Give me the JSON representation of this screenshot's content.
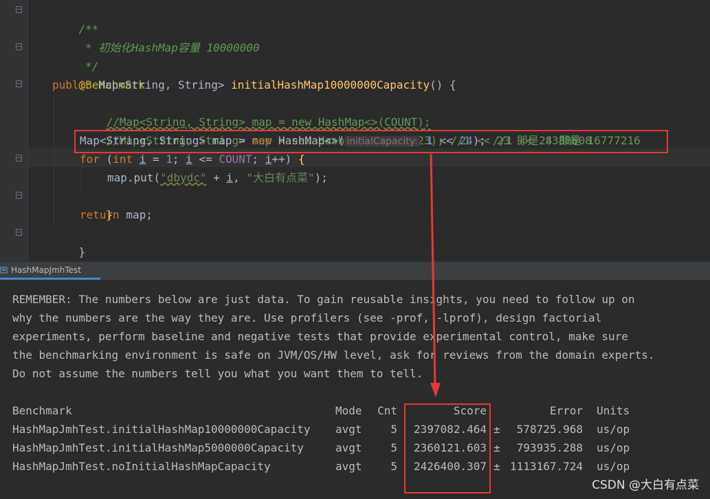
{
  "editor": {
    "lines": {
      "doc_open": "/**",
      "doc_text": " * 初始化HashMap容量 10000000",
      "doc_close": " */",
      "annotation": "@Benchmark",
      "kw_public": "public",
      "sig_type": " Map<String, String> ",
      "method_name": "initialHashMap10000000Capacity",
      "sig_tail": "() {",
      "comment1": "//Map<String, String> map = new HashMap<>(COUNT);",
      "comment2": "//Map<String, String> map = new HashMap<>(1 << 23); //1 << 23 即是 8388608",
      "decl_a": "Map<String, String> map = ",
      "kw_new": "new",
      "decl_b": " HashMap<>(",
      "param_hint": "initialCapacity:",
      "num_1": "1",
      "shift": " << ",
      "num_24": "24",
      "decl_end": ");",
      "decl_comment": " //1 << 24 即是 16777216",
      "kw_for": "for",
      "for_open": " (",
      "kw_int": "int",
      "var_i": "i",
      "assign": " = ",
      "semi1": "; ",
      "le": " <= ",
      "count_field": "COUNT",
      "semi2": "; ",
      "incr": "++) ",
      "brace_open": "{",
      "put_a": "map.put(",
      "str_key": "\"dbydc\"",
      "plus": " + ",
      "comma": ", ",
      "str_val": "\"大白有点菜\"",
      "put_end": ");",
      "brace_close": "}",
      "kw_return": "return",
      "ret_tail": " map;",
      "method_close": "}"
    }
  },
  "console_tab": {
    "label": "HashMapJmhTest",
    "icon": "run-config-icon"
  },
  "console": {
    "remember": [
      "REMEMBER: The numbers below are just data. To gain reusable insights, you need to follow up on",
      "why the numbers are the way they are. Use profilers (see -prof, -lprof), design factorial",
      "experiments, perform baseline and negative tests that provide experimental control, make sure",
      "the benchmarking environment is safe on JVM/OS/HW level, ask for reviews from the domain experts.",
      "Do not assume the numbers tell you what you want them to tell."
    ],
    "headers": {
      "benchmark": "Benchmark",
      "mode": "Mode",
      "cnt": "Cnt",
      "score": "Score",
      "error": "Error",
      "units": "Units"
    },
    "rows": [
      {
        "benchmark": "HashMapJmhTest.initialHashMap10000000Capacity",
        "mode": "avgt",
        "cnt": "5",
        "score": "2397082.464",
        "pm": "±",
        "error": "578725.968",
        "units": "us/op"
      },
      {
        "benchmark": "HashMapJmhTest.initialHashMap5000000Capacity",
        "mode": "avgt",
        "cnt": "5",
        "score": "2360121.603",
        "pm": "±",
        "error": "793935.288",
        "units": "us/op"
      },
      {
        "benchmark": "HashMapJmhTest.noInitialHashMapCapacity",
        "mode": "avgt",
        "cnt": "5",
        "score": "2426400.307",
        "pm": "±",
        "error": "1113167.724",
        "units": "us/op"
      }
    ]
  },
  "watermark": "CSDN @大白有点菜",
  "colors": {
    "highlight_box": "#E53935",
    "tab_accent": "#4A88C7"
  }
}
